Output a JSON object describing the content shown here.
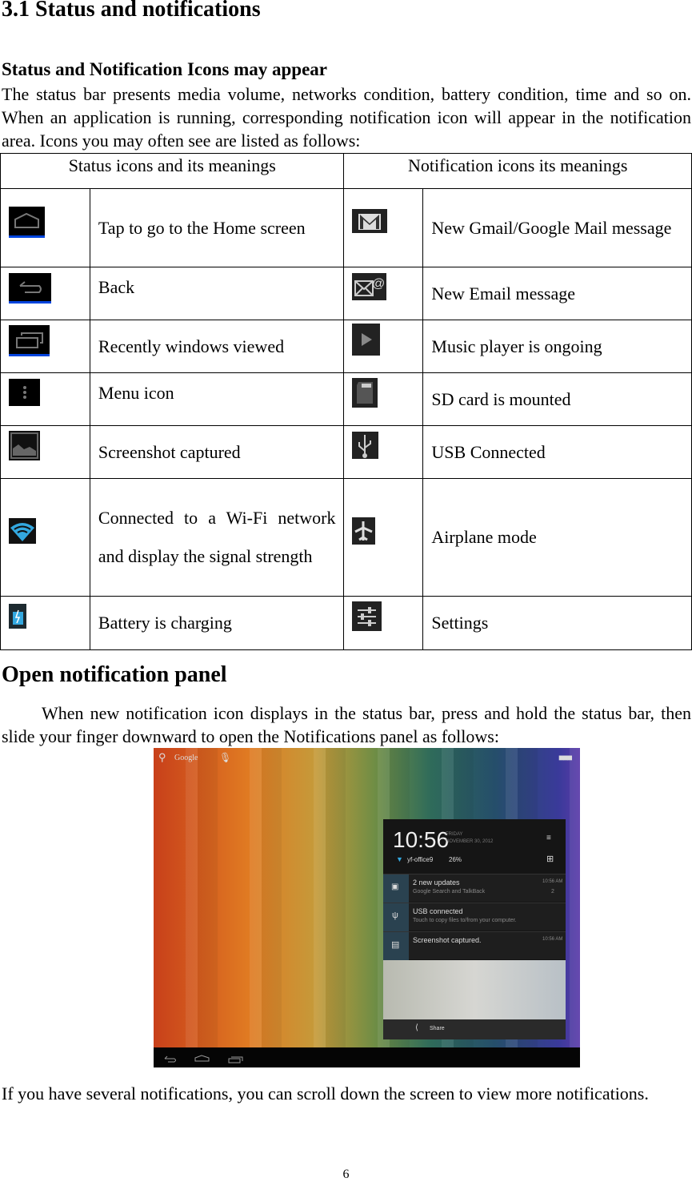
{
  "heading": "3.1 Status and notifications",
  "subheading": "Status and Notification Icons may appear",
  "intro": "The status bar presents media volume, networks condition, battery condition, time and so on. When an application is running, corresponding notification icon will appear in the notification area. Icons you may often see are listed as follows:",
  "table": {
    "headers": [
      "Status icons and its meanings",
      "Notification icons its meanings"
    ],
    "rows": [
      {
        "status_icon": "home-icon",
        "status": "Tap to go to the Home screen",
        "notif_icon": "gmail-icon",
        "notif": "New Gmail/Google Mail message"
      },
      {
        "status_icon": "back-icon",
        "status": "Back",
        "notif_icon": "email-icon",
        "notif": "New Email message"
      },
      {
        "status_icon": "recent-apps-icon",
        "status": "Recently windows viewed",
        "notif_icon": "play-icon",
        "notif": "Music player is ongoing"
      },
      {
        "status_icon": "menu-icon",
        "status": "Menu icon",
        "notif_icon": "sd-card-icon",
        "notif": "SD card is mounted"
      },
      {
        "status_icon": "screenshot-icon",
        "status": "Screenshot captured",
        "notif_icon": "usb-icon",
        "notif": "USB Connected"
      },
      {
        "status_icon": "wifi-icon",
        "status": "Connected to a Wi-Fi network and display the signal strength",
        "notif_icon": "airplane-icon",
        "notif": "Airplane mode"
      },
      {
        "status_icon": "battery-charging-icon",
        "status": "Battery is charging",
        "notif_icon": "settings-icon",
        "notif": "Settings"
      }
    ]
  },
  "section2": "Open notification panel",
  "para2": "When new notification icon displays in the status bar, press and hold the status bar, then slide your finger downward to open the Notifications panel as follows:",
  "screenshot": {
    "search": "Google",
    "time": "10:56",
    "day": "FRIDAY",
    "date": "NOVEMBER 30, 2012",
    "wifi": "yf-office9",
    "battery": "26%",
    "notifications": [
      {
        "title": "2 new updates",
        "text": "Google Search and TalkBack",
        "time": "10:56 AM",
        "count": "2"
      },
      {
        "title": "USB connected",
        "text": "Touch to copy files to/from your computer.",
        "time": ""
      },
      {
        "title": "Screenshot captured.",
        "text": "",
        "time": "10:56 AM"
      }
    ],
    "share": "Share"
  },
  "para3": "If you have several notifications, you can scroll down the screen to view more notifications.",
  "page_number": "6",
  "colors": {
    "nav_underline": "#0044dd",
    "wifi_blue": "#33a8e0"
  }
}
